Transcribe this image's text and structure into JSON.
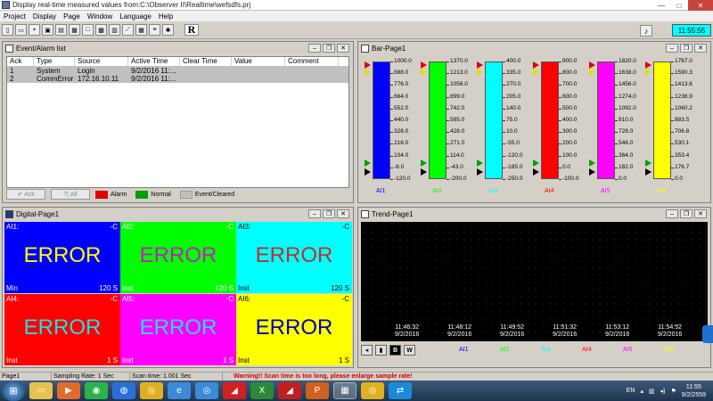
{
  "window": {
    "title": "Display real-time measured values from:C:\\Observer II\\Realtime\\wefsdfs.prj",
    "minimize": "—",
    "maximize": "□",
    "close": "✕"
  },
  "menu": [
    "Project",
    "Display",
    "Page",
    "Window",
    "Language",
    "Help"
  ],
  "toolbar": {
    "r_label": "R",
    "clock": "11:55:55"
  },
  "event_panel": {
    "title": "Event/Alarm list",
    "columns": [
      "Ack",
      "Type",
      "Source",
      "Active Time",
      "Clear Time",
      "Value",
      "Comment"
    ],
    "rows": [
      [
        "1",
        "System",
        "Login",
        "9/2/2016 11:...",
        "",
        "",
        ""
      ],
      [
        "2",
        "CommError",
        "172.16.10.11",
        "9/2/2016 11:...",
        "",
        "",
        ""
      ]
    ],
    "ack_label": "Ack",
    "all_label": "All",
    "legend": [
      {
        "label": "Alarm",
        "color": "#e00000"
      },
      {
        "label": "Normal",
        "color": "#00a000"
      },
      {
        "label": "Event/Cleared",
        "color": "#c0c0c0"
      }
    ]
  },
  "bar_panel": {
    "title": "Bar-Page1",
    "bars": [
      {
        "name": "AI1",
        "color": "#0000ff",
        "ticks": [
          "1000.0",
          "888.0",
          "776.0",
          "664.0",
          "552.0",
          "440.0",
          "328.0",
          "216.0",
          "104.0",
          "-8.0",
          "-120.0"
        ]
      },
      {
        "name": "AI2",
        "color": "#00ff00",
        "ticks": [
          "1370.0",
          "1213.0",
          "1056.0",
          "899.0",
          "742.0",
          "585.0",
          "428.0",
          "271.0",
          "114.0",
          "-43.0",
          "-200.0"
        ]
      },
      {
        "name": "AI3",
        "color": "#00ffff",
        "ticks": [
          "400.0",
          "335.0",
          "270.0",
          "205.0",
          "140.0",
          "75.0",
          "10.0",
          "-55.0",
          "-120.0",
          "-185.0",
          "-250.0"
        ]
      },
      {
        "name": "AI4",
        "color": "#ff0000",
        "ticks": [
          "900.0",
          "800.0",
          "700.0",
          "600.0",
          "500.0",
          "400.0",
          "300.0",
          "200.0",
          "100.0",
          "0.0",
          "-100.0"
        ]
      },
      {
        "name": "AI5",
        "color": "#ff00ff",
        "ticks": [
          "1820.0",
          "1638.0",
          "1456.0",
          "1274.0",
          "1092.0",
          "910.0",
          "728.0",
          "546.0",
          "364.0",
          "182.0",
          "0.0"
        ]
      },
      {
        "name": "AI6",
        "color": "#ffff00",
        "ticks": [
          "1767.0",
          "1590.3",
          "1413.6",
          "1236.9",
          "1060.2",
          "883.5",
          "706.8",
          "530.1",
          "353.4",
          "176.7",
          "0.0"
        ]
      }
    ]
  },
  "digital_panel": {
    "title": "Digital-Page1",
    "cells": [
      {
        "name": "AI1:",
        "unit": "-C",
        "value": "ERROR",
        "mode": "Min",
        "sample": "120 S",
        "bg": "#0000ff",
        "fg": "#ffff00"
      },
      {
        "name": "AI2:",
        "unit": "-C",
        "value": "ERROR",
        "mode": "Inst",
        "sample": "120 S",
        "bg": "#00ff00",
        "fg": "#c020c0"
      },
      {
        "name": "AI3:",
        "unit": "-C",
        "value": "ERROR",
        "mode": "Inst",
        "sample": "120 S",
        "bg": "#00ffff",
        "fg": "#c03030"
      },
      {
        "name": "AI4:",
        "unit": "-C",
        "value": "ERROR",
        "mode": "Inst",
        "sample": "1 S",
        "bg": "#ff0000",
        "fg": "#20e0e0"
      },
      {
        "name": "AI5:",
        "unit": "-C",
        "value": "ERROR",
        "mode": "Inst",
        "sample": "1 S",
        "bg": "#ff00ff",
        "fg": "#20e0e0"
      },
      {
        "name": "AI6:",
        "unit": "-C",
        "value": "ERROR",
        "mode": "Inst",
        "sample": "1 S",
        "bg": "#ffff00",
        "fg": "#0000c0"
      }
    ]
  },
  "trend_panel": {
    "title": "Trend-Page1",
    "times": [
      {
        "t": "11:46:32",
        "d": "9/2/2016"
      },
      {
        "t": "11:48:12",
        "d": "9/2/2016"
      },
      {
        "t": "11:49:52",
        "d": "9/2/2016"
      },
      {
        "t": "11:51:32",
        "d": "9/2/2016"
      },
      {
        "t": "11:53:12",
        "d": "9/2/2016"
      },
      {
        "t": "11:54:52",
        "d": "9/2/2016"
      }
    ],
    "buttons": [
      "B",
      "W"
    ],
    "legend": [
      {
        "label": "AI1",
        "color": "#0000ff"
      },
      {
        "label": "AI2",
        "color": "#00ff00"
      },
      {
        "label": "AI3",
        "color": "#00ffff"
      },
      {
        "label": "AI4",
        "color": "#ff0000"
      },
      {
        "label": "AI5",
        "color": "#ff00ff"
      },
      {
        "label": "AI6",
        "color": "#ffff00"
      }
    ]
  },
  "statusbar": {
    "page": "Page1",
    "sampling": "Sampling Rate: 1 Sec",
    "scan": "Scan time: 1.001 Sec",
    "warning": "Warning!! Scan time is too long, please enlarge sample rate!"
  },
  "taskbar": {
    "lang": "EN",
    "time": "11:55",
    "date": "9/2/2559"
  }
}
